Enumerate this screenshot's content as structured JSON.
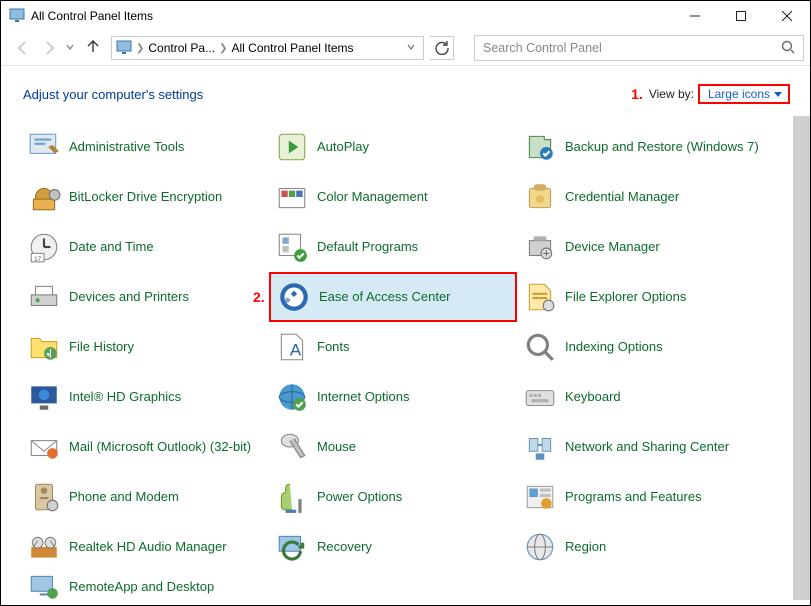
{
  "window": {
    "title": "All Control Panel Items"
  },
  "breadcrumb": {
    "part1": "Control Pa...",
    "part2": "All Control Panel Items"
  },
  "search": {
    "placeholder": "Search Control Panel"
  },
  "header": {
    "adjust": "Adjust your computer's settings",
    "annotation1": "1.",
    "viewby_label": "View by:",
    "viewby_value": "Large icons"
  },
  "annotation2": "2.",
  "items": [
    {
      "label": "Administrative Tools"
    },
    {
      "label": "AutoPlay"
    },
    {
      "label": "Backup and Restore (Windows 7)"
    },
    {
      "label": "BitLocker Drive Encryption"
    },
    {
      "label": "Color Management"
    },
    {
      "label": "Credential Manager"
    },
    {
      "label": "Date and Time"
    },
    {
      "label": "Default Programs"
    },
    {
      "label": "Device Manager"
    },
    {
      "label": "Devices and Printers"
    },
    {
      "label": "Ease of Access Center"
    },
    {
      "label": "File Explorer Options"
    },
    {
      "label": "File History"
    },
    {
      "label": "Fonts"
    },
    {
      "label": "Indexing Options"
    },
    {
      "label": "Intel® HD Graphics"
    },
    {
      "label": "Internet Options"
    },
    {
      "label": "Keyboard"
    },
    {
      "label": "Mail (Microsoft Outlook) (32-bit)"
    },
    {
      "label": "Mouse"
    },
    {
      "label": "Network and Sharing Center"
    },
    {
      "label": "Phone and Modem"
    },
    {
      "label": "Power Options"
    },
    {
      "label": "Programs and Features"
    },
    {
      "label": "Realtek HD Audio Manager"
    },
    {
      "label": "Recovery"
    },
    {
      "label": "Region"
    },
    {
      "label": "RemoteApp and Desktop"
    }
  ]
}
